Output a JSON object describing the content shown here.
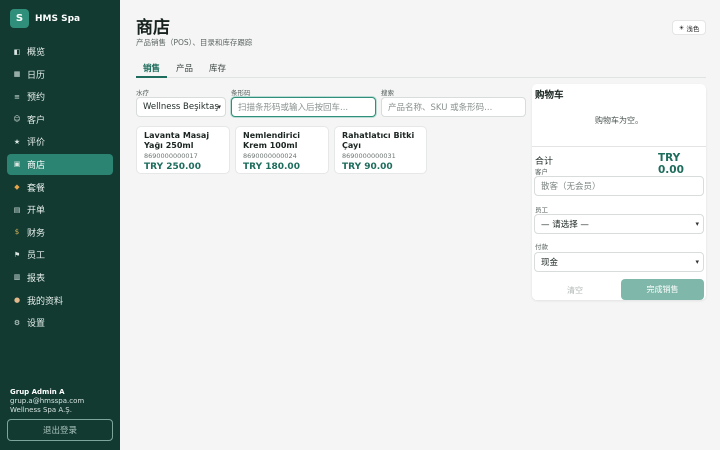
{
  "sidebar": {
    "logo_letter": "S",
    "brand": "HMS Spa",
    "items": [
      {
        "icon": "◧",
        "label": "概览"
      },
      {
        "icon": "▦",
        "label": "日历"
      },
      {
        "icon": "≡",
        "label": "预约"
      },
      {
        "icon": "☺",
        "label": "客户"
      },
      {
        "icon": "★",
        "label": "评价"
      },
      {
        "icon": "▣",
        "label": "商店"
      },
      {
        "icon": "◆",
        "label": "套餐"
      },
      {
        "icon": "▤",
        "label": "开单"
      },
      {
        "icon": "$",
        "label": "财务"
      },
      {
        "icon": "⚑",
        "label": "员工"
      },
      {
        "icon": "▥",
        "label": "报表"
      },
      {
        "icon": "●",
        "label": "我的资料"
      },
      {
        "icon": "⚙",
        "label": "设置"
      }
    ],
    "active_index": 5,
    "user": {
      "name": "Grup Admin A",
      "email": "grup.a@hmsspa.com",
      "company": "Wellness Spa A.Ş."
    },
    "logout": "退出登录"
  },
  "header": {
    "title": "商店",
    "subtitle": "产品销售（POS）、目录和库存跟踪",
    "theme_icon": "☀",
    "theme_label": "浅色"
  },
  "tabs": [
    "销售",
    "产品",
    "库存"
  ],
  "filters": {
    "spa_label": "水疗",
    "spa_value": "Wellness Beşiktaş",
    "barcode_label": "条形码",
    "barcode_placeholder": "扫描条形码或输入后按回车...",
    "search_label": "搜索",
    "search_placeholder": "产品名称、SKU 或条形码..."
  },
  "products": [
    {
      "name": "Lavanta Masaj Yağı 250ml",
      "sku": "8690000000017",
      "price": "TRY 250.00"
    },
    {
      "name": "Nemlendirici Krem 100ml",
      "sku": "8690000000024",
      "price": "TRY 180.00"
    },
    {
      "name": "Rahatlatıcı Bitki Çayı",
      "sku": "8690000000031",
      "price": "TRY 90.00"
    }
  ],
  "cart": {
    "title": "购物车",
    "empty": "购物车为空。",
    "total_label": "合计",
    "total_value": "TRY 0.00",
    "customer_label": "客户",
    "customer_placeholder": "散客（无会员）",
    "staff_label": "员工",
    "staff_value": "— 请选择 —",
    "payment_label": "付款",
    "payment_value": "现金",
    "clear": "清空",
    "complete": "完成销售"
  },
  "colors": {
    "sidebar": "#123a31",
    "accent": "#1d6c5c",
    "active_nav": "#2a8471",
    "complete_button": "#7fb8aa"
  }
}
